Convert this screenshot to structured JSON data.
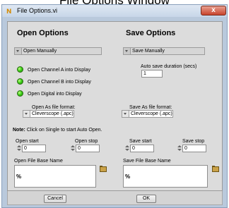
{
  "banner": {
    "text": "File Options Window"
  },
  "window": {
    "title": "File Options.vi",
    "close_label": "x"
  },
  "open": {
    "heading": "Open Options",
    "mode": "Open Manually",
    "leds": [
      {
        "label": "Open Channel A into Display"
      },
      {
        "label": "Open Channel B into Display"
      },
      {
        "label": "Open Digital into Display"
      }
    ],
    "format_label": "Open As file format:",
    "format_value": "Cleverscope (.apc)",
    "start_label": "Open start",
    "start_value": "0",
    "stop_label": "Open stop",
    "stop_value": "0",
    "base_name_label": "Open File Base Name",
    "base_name_prefix": "%"
  },
  "save": {
    "heading": "Save Options",
    "mode": "Save Manually",
    "duration_label": "Auto save duration (secs)",
    "duration_value": "1",
    "format_label": "Save As file format:",
    "format_value": "Cleverscope (.apc)",
    "start_label": "Save start",
    "start_value": "0",
    "stop_label": "Save stop",
    "stop_value": "0",
    "base_name_label": "Save File Base Name",
    "base_name_prefix": "%"
  },
  "note": {
    "bold": "Note:",
    "text": " Click on Single to start Auto Open."
  },
  "buttons": {
    "cancel": "Cancel",
    "ok": "OK"
  },
  "colors": {
    "led_on": "#3fd21a",
    "panel_bg": "#dcdcdc",
    "frame": "#b9c9dc"
  }
}
